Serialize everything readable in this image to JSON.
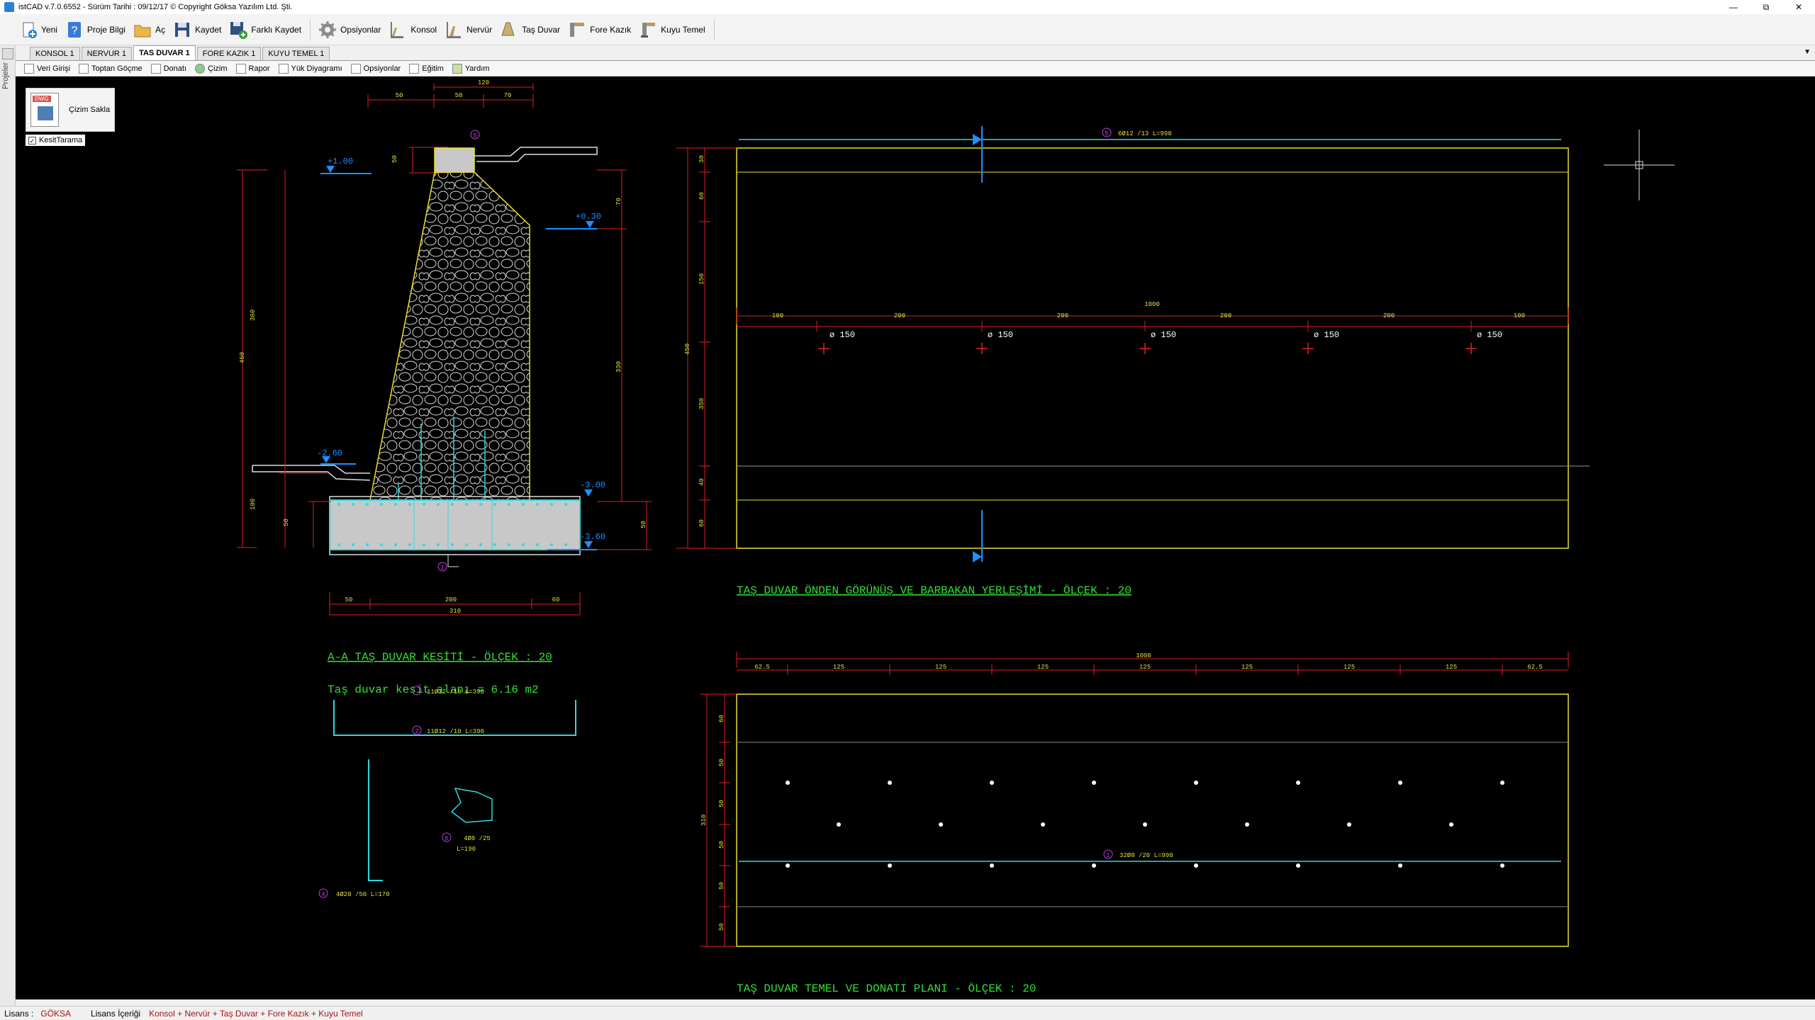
{
  "window": {
    "title": "istCAD v.7.0.6552 -  Sürüm Tarihi : 09/12/17  © Copyright Göksa Yazılım Ltd. Şti."
  },
  "toolbar": {
    "items": [
      {
        "label": "Yeni",
        "icon": "new-file-icon"
      },
      {
        "label": "Proje Bilgi",
        "icon": "help-icon"
      },
      {
        "label": "Aç",
        "icon": "folder-icon"
      },
      {
        "label": "Kaydet",
        "icon": "save-icon"
      },
      {
        "label": "Farklı Kaydet",
        "icon": "save-as-icon"
      },
      {
        "label": "Opsiyonlar",
        "icon": "gear-icon"
      },
      {
        "label": "Konsol",
        "icon": "konsol-icon"
      },
      {
        "label": "Nervür",
        "icon": "nervur-icon"
      },
      {
        "label": "Taş Duvar",
        "icon": "tas-duvar-icon"
      },
      {
        "label": "Fore Kazık",
        "icon": "fore-kazik-icon"
      },
      {
        "label": "Kuyu Temel",
        "icon": "kuyu-temel-icon"
      }
    ]
  },
  "side_strip": {
    "label": "Projeler"
  },
  "tabs": [
    {
      "label": "KONSOL 1"
    },
    {
      "label": "NERVUR 1"
    },
    {
      "label": "TAS DUVAR 1",
      "active": true
    },
    {
      "label": "FORE KAZIK 1"
    },
    {
      "label": "KUYU TEMEL 1"
    }
  ],
  "subtoolbar": {
    "items": [
      {
        "label": "Veri Girişi"
      },
      {
        "label": "Toptan Göçme"
      },
      {
        "label": "Donatı"
      },
      {
        "label": "Çizim"
      },
      {
        "label": "Rapor"
      },
      {
        "label": "Yük Diyagramı"
      },
      {
        "label": "Opsiyonlar"
      },
      {
        "label": "Eğitim"
      },
      {
        "label": "Yardım"
      }
    ]
  },
  "drawing_panel": {
    "save_label": "Çizim Sakla",
    "dwg_tag": "DWG",
    "checkbox_label": "KesitTarama",
    "checkbox_checked": true
  },
  "drawing": {
    "section_title": "A-A TAŞ DUVAR KESİTİ - ÖLÇEK : 20",
    "section_area": "Taş duvar kesit alanı = 6.16 m2",
    "front_title": "TAŞ DUVAR ÖNDEN GÖRÜNÜŞ VE BARBAKAN YERLEŞİMİ - ÖLÇEK : 20",
    "plan_title": "TAŞ DUVAR TEMEL VE DONATI PLANI - ÖLÇEK : 20",
    "elevations": [
      "+1.00",
      "+0.30",
      "-2.60",
      "-3.00",
      "-3.60"
    ],
    "section_dims": {
      "top": [
        "50",
        "50",
        "70"
      ],
      "top_total": "120",
      "bottom": [
        "50",
        "200",
        "60"
      ],
      "bottom_total": "310",
      "left_height": "460",
      "left_wall": "360",
      "left_base": "100",
      "left_base_part": "50",
      "right_top": "70",
      "right_mid": "330",
      "right_base": "50",
      "crest": "50"
    },
    "front_dims": {
      "total": "1000",
      "segments": [
        "100",
        "200",
        "200",
        "200",
        "200",
        "100"
      ],
      "left_height": "450",
      "left_parts": [
        "30",
        "60",
        "150",
        "350",
        "40",
        "60"
      ],
      "drain": "ø 150",
      "rebar_top": "6Ø12 /13      L=990",
      "rebar_top_mark": "5"
    },
    "plan_dims": {
      "total": "1000",
      "segments": [
        "62.5",
        "125",
        "125",
        "125",
        "125",
        "125",
        "125",
        "125",
        "62.5"
      ],
      "left_height": "310",
      "left_parts": [
        "60",
        "50",
        "50",
        "50",
        "50",
        "50"
      ],
      "rebar": "32Ø8 /20      L=990",
      "rebar_mark": "1"
    },
    "bar_schedule": [
      {
        "mark": "3",
        "text": "11Ø12 /10      L=390"
      },
      {
        "mark": "2",
        "text": "11Ø12 /10      L=390"
      },
      {
        "mark": "6",
        "text": "4Ø8 /25",
        "length": "L=190"
      },
      {
        "mark": "4",
        "text": "4Ø20 /50      L=170"
      }
    ]
  },
  "statusbar": {
    "license_label": "Lisans :",
    "license_value": "GÖKSA",
    "content_label": "Lisans İçeriği",
    "content_value": "Konsol + Nervür + Taş Duvar + Fore Kazık + Kuyu Temel"
  },
  "colors": {
    "canvas": "#000000",
    "red_dim": "#e02020",
    "yellow": "#e8e030",
    "cyan": "#30d8e0",
    "green_text": "#30e030",
    "blue_marker": "#1e90ff",
    "magenta": "#c040e0"
  }
}
